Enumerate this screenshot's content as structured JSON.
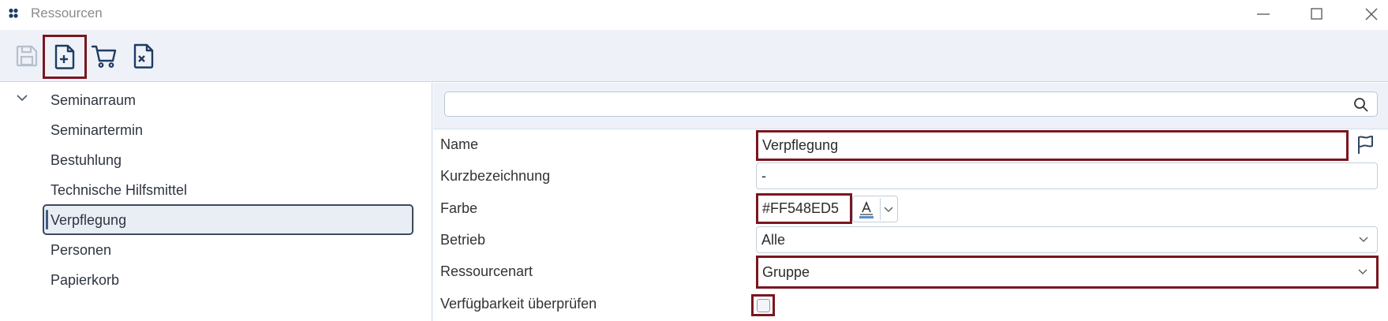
{
  "window": {
    "title": "Ressourcen",
    "minimize_icon": "minimize-icon",
    "maximize_icon": "maximize-icon",
    "close_icon": "close-icon"
  },
  "toolbar": {
    "buttons": [
      {
        "name": "save-button",
        "icon": "save-icon",
        "enabled": false
      },
      {
        "name": "new-document-button",
        "icon": "new-document-icon",
        "highlighted": true
      },
      {
        "name": "cart-button",
        "icon": "cart-icon"
      },
      {
        "name": "delete-document-button",
        "icon": "delete-document-icon"
      }
    ]
  },
  "tree": {
    "root": {
      "label": "Seminarraum",
      "expanded": true
    },
    "items": [
      {
        "label": "Seminartermin"
      },
      {
        "label": "Bestuhlung"
      },
      {
        "label": "Technische Hilfsmittel"
      },
      {
        "label": "Verpflegung",
        "selected": true
      },
      {
        "label": "Personen"
      },
      {
        "label": "Papierkorb"
      }
    ]
  },
  "search": {
    "value": "",
    "placeholder": ""
  },
  "form": {
    "name": {
      "label": "Name",
      "value": "Verpflegung"
    },
    "kurz": {
      "label": "Kurzbezeichnung",
      "value": "-"
    },
    "farbe": {
      "label": "Farbe",
      "value": "#FF548ED5"
    },
    "betrieb": {
      "label": "Betrieb",
      "value": "Alle"
    },
    "ressourcenart": {
      "label": "Ressourcenart",
      "value": "Gruppe"
    },
    "verfuegbarkeit": {
      "label": "Verfügbarkeit überprüfen",
      "checked": false
    }
  },
  "colors": {
    "highlight": "#7a1620",
    "toolbar_bg": "#eef2f8",
    "selection_bg": "#e9eef5",
    "color_swatch": "#548ED5"
  }
}
